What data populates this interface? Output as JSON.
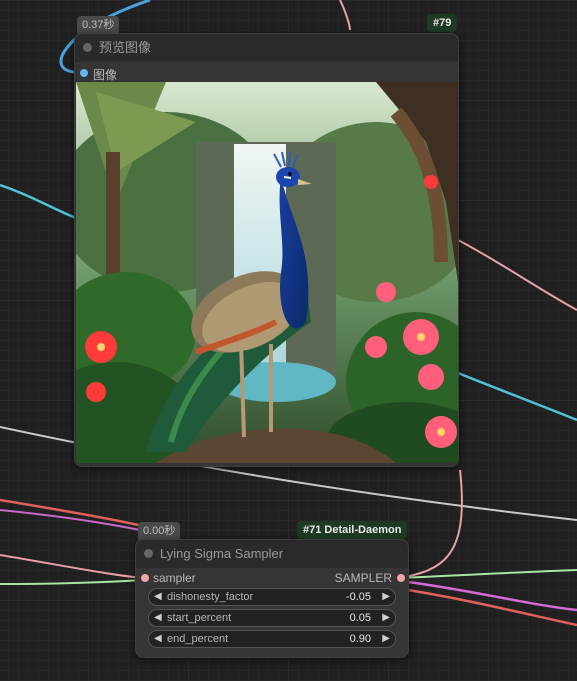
{
  "colors": {
    "node_bg": "#353535",
    "node_title_bg": "#2a2a2a",
    "id_badge_bg": "#1e3a23",
    "image_slot_color": "#64b5f6",
    "sampler_slot_color": "#f4a7a7",
    "wire_blue": "#4fc3d8",
    "wire_pink": "#f19aa8",
    "wire_green": "#a8e6a1",
    "wire_magenta": "#d86bd8",
    "wire_red": "#e0605a",
    "wire_grey": "#c8c8c8"
  },
  "preview_node": {
    "exec_time": "0.37秒",
    "id_badge": "#79",
    "title": "预览图像",
    "input_label": "图像",
    "image_description_icon": "image-icon"
  },
  "sampler_node": {
    "exec_time": "0.00秒",
    "id_badge": "#71 Detail-Daemon",
    "title": "Lying Sigma Sampler",
    "input_label": "sampler",
    "output_label": "SAMPLER",
    "widgets": [
      {
        "name": "dishonesty_factor",
        "value": "-0.05"
      },
      {
        "name": "start_percent",
        "value": "0.05"
      },
      {
        "name": "end_percent",
        "value": "0.90"
      }
    ]
  },
  "icons": {
    "left_arrow": "◀",
    "right_arrow": "▶"
  }
}
